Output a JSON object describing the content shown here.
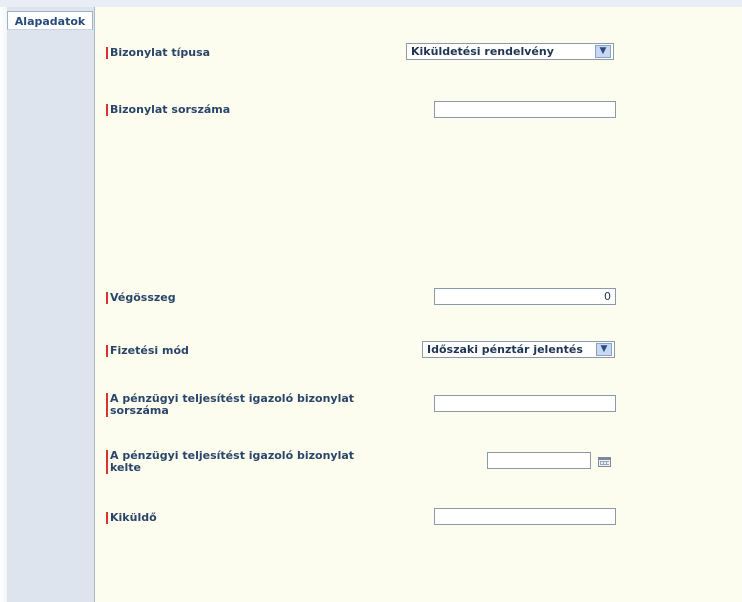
{
  "tabs": {
    "active_label": "Alapadatok"
  },
  "form": {
    "bizonylat_tipusa": {
      "label": "Bizonylat típusa",
      "selected": "Kiküldetési rendelvény"
    },
    "bizonylat_sorszama": {
      "label": "Bizonylat sorszáma",
      "value": ""
    },
    "vegosszeg": {
      "label": "Végösszeg",
      "value": "0"
    },
    "fizetesi_mod": {
      "label": "Fizetési mód",
      "selected": "Időszaki pénztár jelentés"
    },
    "igazolo_sorszama": {
      "label": "A pénzügyi teljesítést igazoló bizonylat sorszáma",
      "value": ""
    },
    "igazolo_kelte": {
      "label": "A pénzügyi teljesítést igazoló bizonylat kelte",
      "value": ""
    },
    "kikuldo": {
      "label": "Kiküldő",
      "value": ""
    }
  },
  "icons": {
    "dropdown": "chevron-down-icon",
    "calendar": "calendar-icon"
  },
  "colors": {
    "panel_bg": "#fcfdee",
    "sidebar_bg": "#dde4ee",
    "required_marker": "#d6332f",
    "label_text": "#2a456a"
  }
}
